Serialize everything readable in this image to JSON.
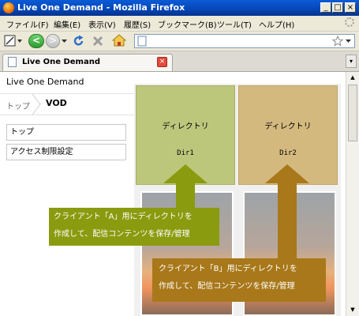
{
  "window": {
    "title": "Live One Demand - Mozilla Firefox"
  },
  "menu": [
    "ファイル(F)",
    "編集(E)",
    "表示(V)",
    "履歴(S)",
    "ブックマーク(B)",
    "ツール(T)",
    "ヘルプ(H)"
  ],
  "tab": {
    "label": "Live One Demand"
  },
  "page": {
    "site_title": "Live One Demand",
    "breadcrumb": {
      "home": "トップ",
      "current": "VOD"
    },
    "side_menu": [
      "トップ",
      "アクセス制限設定"
    ],
    "directories": [
      {
        "name": "ディレクトリ",
        "code": "Dir1"
      },
      {
        "name": "ディレクトリ",
        "code": "Dir2"
      }
    ],
    "callouts": {
      "a": {
        "line1": "クライアント「A」用にディレクトリを",
        "line2": "作成して、配信コンテンツを保存/管理"
      },
      "b": {
        "line1": "クライアント「B」用にディレクトリを",
        "line2": "作成して、配信コンテンツを保存/管理"
      }
    }
  },
  "colors": {
    "callout_a": "#8a9b0f",
    "callout_b": "#a8781a",
    "dir_a": "#bdc77c",
    "dir_b": "#d4b97f"
  }
}
